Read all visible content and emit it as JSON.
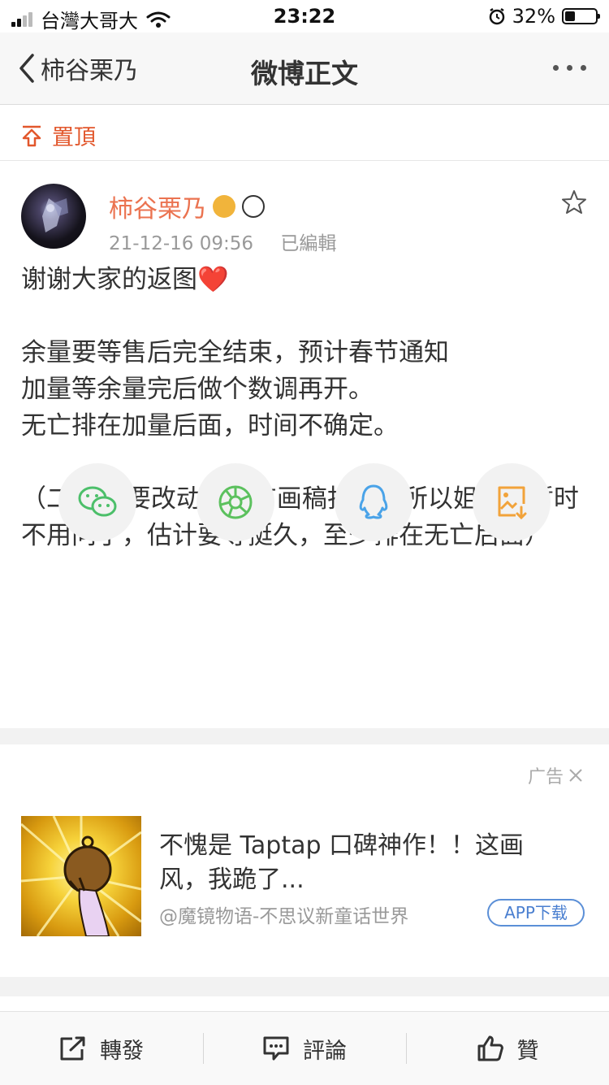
{
  "status_bar": {
    "carrier": "台灣大哥大",
    "time": "23:22",
    "battery_percent": "32%",
    "battery_level": 0.32,
    "signal_bars": 2
  },
  "nav": {
    "back_label": "柿谷栗乃",
    "title": "微博正文"
  },
  "pin": {
    "label": "置頂"
  },
  "post": {
    "author": "柿谷栗乃",
    "timestamp": "21-12-16 09:56",
    "edited": "已編輯",
    "paragraphs": [
      "谢谢大家的返图❤️",
      "余量要等售后完全结束，预计春节通知\n加量等余量完后做个数调再开。\n无亡排在加量后面，时间不确定。",
      "（二贩sp要改动还没有画稿打样，所以姐妹们暂时不用问了，估计要等挺久，至少排在无亡后面）"
    ]
  },
  "share": [
    "wechat-icon",
    "moments-icon",
    "qq-icon",
    "save-image-icon"
  ],
  "ad": {
    "tag": "广告",
    "title": "不愧是 Taptap 口碑神作！！这画风，我跪了...",
    "source": "@魔镜物语-不思议新童话世界",
    "app_button": "APP下载"
  },
  "toolbar": {
    "repost": "轉發",
    "comment": "評論",
    "like": "贊"
  },
  "colors": {
    "accent_orange": "#eb7350",
    "pin_red": "#e2572c",
    "app_blue": "#4a7fd0"
  }
}
